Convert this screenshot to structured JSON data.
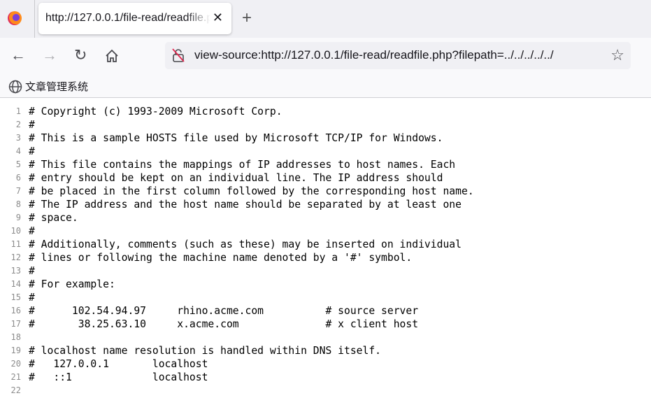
{
  "tab": {
    "title": "http://127.0.0.1/file-read/readfile.php?filepath=../../../../../"
  },
  "address": {
    "url": "view-source:http://127.0.0.1/file-read/readfile.php?filepath=../../../../../"
  },
  "bookmarks": [
    {
      "label": "文章管理系统",
      "icon": "globe-icon"
    }
  ],
  "source_lines": [
    "# Copyright (c) 1993-2009 Microsoft Corp.",
    "#",
    "# This is a sample HOSTS file used by Microsoft TCP/IP for Windows.",
    "#",
    "# This file contains the mappings of IP addresses to host names. Each",
    "# entry should be kept on an individual line. The IP address should",
    "# be placed in the first column followed by the corresponding host name.",
    "# The IP address and the host name should be separated by at least one",
    "# space.",
    "#",
    "# Additionally, comments (such as these) may be inserted on individual",
    "# lines or following the machine name denoted by a '#' symbol.",
    "#",
    "# For example:",
    "#",
    "#      102.54.94.97     rhino.acme.com          # source server",
    "#       38.25.63.10     x.acme.com              # x client host",
    "",
    "# localhost name resolution is handled within DNS itself.",
    "#   127.0.0.1       localhost",
    "#   ::1             localhost",
    ""
  ]
}
